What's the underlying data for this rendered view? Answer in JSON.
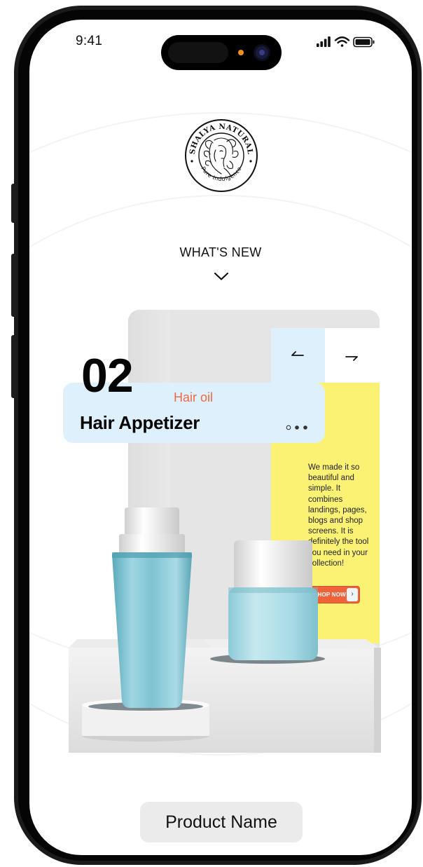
{
  "status_bar": {
    "time": "9:41"
  },
  "brand": {
    "name": "SHALYA NATURAL",
    "tagline": "Pure Indulgence"
  },
  "section": {
    "heading": "WHAT'S NEW"
  },
  "product": {
    "number": "02",
    "category": "Hair oil",
    "title": "Hair Appetizer",
    "description": "We made it so beautiful and simple. It combines landings, pages, blogs and shop screens. It is definitely the tool you need in your collection!",
    "shop_button": "SHOP NOW",
    "slide_indicator": {
      "total": 3,
      "active_index": 0
    }
  },
  "footer": {
    "product_name_label": "Product Name"
  },
  "colors": {
    "accent": "#f0633a",
    "panel_yellow": "#fbf274",
    "panel_blue": "#ddf0fb",
    "bottle_teal": "#7fc3d2"
  },
  "icons": {
    "prev": "arrow-left-icon",
    "next": "arrow-right-icon",
    "expand": "chevron-down-icon"
  }
}
